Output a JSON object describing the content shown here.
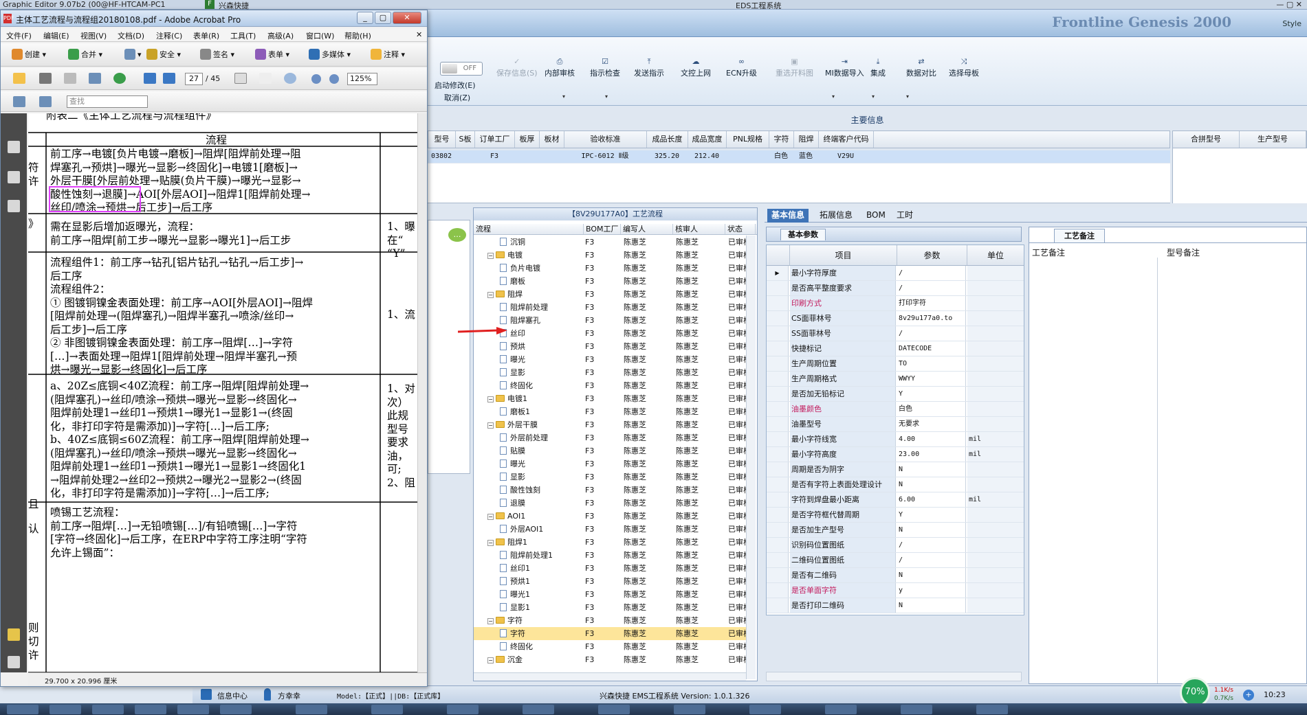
{
  "os": {
    "title_left": "Graphic Editor 9.07b2 (00@HF-HTCAM-PC1",
    "eds_title": "EDS工程系统",
    "tab_left": "兴森快捷"
  },
  "eds": {
    "brand": "Frontline Genesis 2000",
    "style_label": "Style",
    "toggle": "OFF",
    "ribbon": [
      {
        "label": "启动修改(E)",
        "icon": "toggle-icon",
        "disabled": false
      },
      {
        "label": "保存信息(S)",
        "icon": "check-icon",
        "disabled": true
      },
      {
        "label": "内部审核",
        "icon": "printer-icon",
        "disabled": false
      },
      {
        "label": "指示检查",
        "icon": "checkbox-icon",
        "disabled": false
      },
      {
        "label": "发送指示",
        "icon": "upload-icon",
        "disabled": false
      },
      {
        "label": "文控上网",
        "icon": "cloud-upload-icon",
        "disabled": false
      },
      {
        "label": "ECN升级",
        "icon": "binoculars-icon",
        "disabled": false
      },
      {
        "label": "重选开料图",
        "icon": "image-icon",
        "disabled": true
      },
      {
        "label": "MI数据导入",
        "icon": "import-icon",
        "disabled": false
      },
      {
        "label": "集成",
        "icon": "download-icon",
        "disabled": false
      },
      {
        "label": "数据对比",
        "icon": "compare-icon",
        "disabled": false
      },
      {
        "label": "选择母板",
        "icon": "shuffle-icon",
        "disabled": false
      }
    ],
    "cancel_label": "取消(Z)",
    "main_info_title": "主要信息",
    "main_columns": [
      "型号",
      "S板",
      "订单工厂",
      "板厚",
      "板材",
      "验收标准",
      "成品长度",
      "成品宽度",
      "PNL规格",
      "字符",
      "阻焊",
      "终端客户代码"
    ],
    "main_row": [
      "03802",
      "",
      "F3",
      "",
      "",
      "IPC-6012 Ⅱ级",
      "325.20",
      "212.40",
      "",
      "白色",
      "蓝色",
      "V29U"
    ],
    "right_columns": [
      "合拼型号",
      "生产型号"
    ],
    "tree_title": "【8V29U177A0】工艺流程",
    "tree_columns": [
      "流程",
      "BOM工厂",
      "编写人",
      "核审人",
      "状态"
    ],
    "tree_rows": [
      {
        "name": "沉铜",
        "level": 2,
        "kind": "doc",
        "bom": "F3",
        "writer": "陈惠芝",
        "checker": "陈惠芝",
        "status": "已审核"
      },
      {
        "name": "电镀",
        "level": 1,
        "kind": "folder",
        "bom": "F3",
        "writer": "陈惠芝",
        "checker": "陈惠芝",
        "status": "已审核"
      },
      {
        "name": "负片电镀",
        "level": 2,
        "kind": "doc",
        "bom": "F3",
        "writer": "陈惠芝",
        "checker": "陈惠芝",
        "status": "已审核"
      },
      {
        "name": "磨板",
        "level": 2,
        "kind": "doc",
        "bom": "F3",
        "writer": "陈惠芝",
        "checker": "陈惠芝",
        "status": "已审核"
      },
      {
        "name": "阻焊",
        "level": 1,
        "kind": "folder",
        "bom": "F3",
        "writer": "陈惠芝",
        "checker": "陈惠芝",
        "status": "已审核"
      },
      {
        "name": "阻焊前处理",
        "level": 2,
        "kind": "doc",
        "bom": "F3",
        "writer": "陈惠芝",
        "checker": "陈惠芝",
        "status": "已审核"
      },
      {
        "name": "阻焊塞孔",
        "level": 2,
        "kind": "doc",
        "bom": "F3",
        "writer": "陈惠芝",
        "checker": "陈惠芝",
        "status": "已审核"
      },
      {
        "name": "丝印",
        "level": 2,
        "kind": "doc",
        "bom": "F3",
        "writer": "陈惠芝",
        "checker": "陈惠芝",
        "status": "已审核"
      },
      {
        "name": "预烘",
        "level": 2,
        "kind": "doc",
        "bom": "F3",
        "writer": "陈惠芝",
        "checker": "陈惠芝",
        "status": "已审核"
      },
      {
        "name": "曝光",
        "level": 2,
        "kind": "doc",
        "bom": "F3",
        "writer": "陈惠芝",
        "checker": "陈惠芝",
        "status": "已审核"
      },
      {
        "name": "显影",
        "level": 2,
        "kind": "doc",
        "bom": "F3",
        "writer": "陈惠芝",
        "checker": "陈惠芝",
        "status": "已审核"
      },
      {
        "name": "终固化",
        "level": 2,
        "kind": "doc",
        "bom": "F3",
        "writer": "陈惠芝",
        "checker": "陈惠芝",
        "status": "已审核"
      },
      {
        "name": "电镀1",
        "level": 1,
        "kind": "folder",
        "bom": "F3",
        "writer": "陈惠芝",
        "checker": "陈惠芝",
        "status": "已审核"
      },
      {
        "name": "磨板1",
        "level": 2,
        "kind": "doc",
        "bom": "F3",
        "writer": "陈惠芝",
        "checker": "陈惠芝",
        "status": "已审核"
      },
      {
        "name": "外层干膜",
        "level": 1,
        "kind": "folder",
        "bom": "F3",
        "writer": "陈惠芝",
        "checker": "陈惠芝",
        "status": "已审核"
      },
      {
        "name": "外层前处理",
        "level": 2,
        "kind": "doc",
        "bom": "F3",
        "writer": "陈惠芝",
        "checker": "陈惠芝",
        "status": "已审核"
      },
      {
        "name": "贴膜",
        "level": 2,
        "kind": "doc",
        "bom": "F3",
        "writer": "陈惠芝",
        "checker": "陈惠芝",
        "status": "已审核"
      },
      {
        "name": "曝光",
        "level": 2,
        "kind": "doc",
        "bom": "F3",
        "writer": "陈惠芝",
        "checker": "陈惠芝",
        "status": "已审核"
      },
      {
        "name": "显影",
        "level": 2,
        "kind": "doc",
        "bom": "F3",
        "writer": "陈惠芝",
        "checker": "陈惠芝",
        "status": "已审核"
      },
      {
        "name": "酸性蚀刻",
        "level": 2,
        "kind": "doc",
        "bom": "F3",
        "writer": "陈惠芝",
        "checker": "陈惠芝",
        "status": "已审核"
      },
      {
        "name": "退膜",
        "level": 2,
        "kind": "doc",
        "bom": "F3",
        "writer": "陈惠芝",
        "checker": "陈惠芝",
        "status": "已审核"
      },
      {
        "name": "AOI1",
        "level": 1,
        "kind": "folder",
        "bom": "F3",
        "writer": "陈惠芝",
        "checker": "陈惠芝",
        "status": "已审核"
      },
      {
        "name": "外层AOI1",
        "level": 2,
        "kind": "doc",
        "bom": "F3",
        "writer": "陈惠芝",
        "checker": "陈惠芝",
        "status": "已审核"
      },
      {
        "name": "阻焊1",
        "level": 1,
        "kind": "folder",
        "bom": "F3",
        "writer": "陈惠芝",
        "checker": "陈惠芝",
        "status": "已审核"
      },
      {
        "name": "阻焊前处理1",
        "level": 2,
        "kind": "doc",
        "bom": "F3",
        "writer": "陈惠芝",
        "checker": "陈惠芝",
        "status": "已审核"
      },
      {
        "name": "丝印1",
        "level": 2,
        "kind": "doc",
        "bom": "F3",
        "writer": "陈惠芝",
        "checker": "陈惠芝",
        "status": "已审核"
      },
      {
        "name": "预烘1",
        "level": 2,
        "kind": "doc",
        "bom": "F3",
        "writer": "陈惠芝",
        "checker": "陈惠芝",
        "status": "已审核"
      },
      {
        "name": "曝光1",
        "level": 2,
        "kind": "doc",
        "bom": "F3",
        "writer": "陈惠芝",
        "checker": "陈惠芝",
        "status": "已审核"
      },
      {
        "name": "显影1",
        "level": 2,
        "kind": "doc",
        "bom": "F3",
        "writer": "陈惠芝",
        "checker": "陈惠芝",
        "status": "已审核"
      },
      {
        "name": "字符",
        "level": 1,
        "kind": "folder",
        "bom": "F3",
        "writer": "陈惠芝",
        "checker": "陈惠芝",
        "status": "已审核"
      },
      {
        "name": "字符",
        "level": 2,
        "kind": "doc",
        "bom": "F3",
        "writer": "陈惠芝",
        "checker": "陈惠芝",
        "status": "已审核",
        "selected": true
      },
      {
        "name": "终固化",
        "level": 2,
        "kind": "doc",
        "bom": "F3",
        "writer": "陈惠芝",
        "checker": "陈惠芝",
        "status": "已审核"
      },
      {
        "name": "沉金",
        "level": 1,
        "kind": "folder",
        "bom": "F3",
        "writer": "陈惠芝",
        "checker": "陈惠芝",
        "status": "已审核"
      }
    ],
    "tabs": [
      "基本信息",
      "拓展信息",
      "BOM",
      "工时"
    ],
    "basic_params_title": "基本参数",
    "param_columns": [
      "项目",
      "参数",
      "单位"
    ],
    "params": [
      {
        "k": "最小字符厚度",
        "v": "/",
        "u": "",
        "pink": false
      },
      {
        "k": "是否高平整度要求",
        "v": "/",
        "u": "",
        "pink": false
      },
      {
        "k": "印刷方式",
        "v": "打印字符",
        "u": "",
        "pink": true
      },
      {
        "k": "CS面菲林号",
        "v": "8v29u177a0.to",
        "u": "",
        "pink": false
      },
      {
        "k": "SS面菲林号",
        "v": "/",
        "u": "",
        "pink": false
      },
      {
        "k": "快捷标记",
        "v": "DATECODE",
        "u": "",
        "pink": false
      },
      {
        "k": "生产周期位置",
        "v": "TO",
        "u": "",
        "pink": false
      },
      {
        "k": "生产周期格式",
        "v": "WWYY",
        "u": "",
        "pink": false
      },
      {
        "k": "是否加无铅标记",
        "v": "Y",
        "u": "",
        "pink": false
      },
      {
        "k": "油墨颜色",
        "v": "白色",
        "u": "",
        "pink": true
      },
      {
        "k": "油墨型号",
        "v": "无要求",
        "u": "",
        "pink": false
      },
      {
        "k": "最小字符线宽",
        "v": "4.00",
        "u": "mil",
        "pink": false
      },
      {
        "k": "最小字符高度",
        "v": "23.00",
        "u": "mil",
        "pink": false
      },
      {
        "k": "周期是否为阴字",
        "v": "N",
        "u": "",
        "pink": false
      },
      {
        "k": "是否有字符上表面处理设计",
        "v": "N",
        "u": "",
        "pink": false
      },
      {
        "k": "字符到焊盘最小距离",
        "v": "6.00",
        "u": "mil",
        "pink": false
      },
      {
        "k": "是否字符框代替周期",
        "v": "Y",
        "u": "",
        "pink": false
      },
      {
        "k": "是否加生产型号",
        "v": "N",
        "u": "",
        "pink": false
      },
      {
        "k": "识别码位置图纸",
        "v": "/",
        "u": "",
        "pink": false
      },
      {
        "k": "二维码位置图纸",
        "v": "/",
        "u": "",
        "pink": false
      },
      {
        "k": "是否有二维码",
        "v": "N",
        "u": "",
        "pink": false
      },
      {
        "k": "是否单面字符",
        "v": "y",
        "u": "",
        "pink": true
      },
      {
        "k": "是否打印二维码",
        "v": "N",
        "u": "",
        "pink": false
      }
    ],
    "remark_tab": "工艺备注",
    "remark_columns": [
      "工艺备注",
      "型号备注"
    ],
    "status": {
      "info_center": "信息中心",
      "user": "方幸幸",
      "model": "Model:【正式】||DB:【正式库】",
      "app": "兴森快捷  EMS工程系统  Version: 1.0.1.326",
      "gauge": "70%",
      "up": "1.1K/s",
      "down": "0.7K/s",
      "time": "10:23"
    }
  },
  "acrobat": {
    "title": "主体工艺流程与流程组20180108.pdf - Adobe Acrobat Pro",
    "menu": [
      "文件(F)",
      "编辑(E)",
      "视图(V)",
      "文档(D)",
      "注释(C)",
      "表单(R)",
      "工具(T)",
      "高级(A)",
      "窗口(W)",
      "帮助(H)"
    ],
    "toolbar": [
      "创建",
      "合并",
      "",
      "安全",
      "签名",
      "表单",
      "多媒体",
      "注释"
    ],
    "page_current": "27",
    "page_total": "/ 45",
    "zoom": "125%",
    "find_placeholder": "查找",
    "page_size": "29.700 x 20.996 厘米",
    "doc": {
      "heading": "附表二《主体工艺流程与流程组件》",
      "col_header": "流程",
      "left_marks": [
        "符",
        "许",
        "》",
        "且",
        "认",
        "则",
        "切",
        "许"
      ],
      "block1": [
        "前工序→电镀[负片电镀→磨板]→阻焊[阻焊前处理→阻",
        "焊塞孔→预烘]→曝光→显影→终固化]→电镀1[磨板]→",
        "外层干膜[外层前处理→贴膜(负片干膜)→曝光→显影→",
        "酸性蚀刻→退膜]→AOI[外层AOI]→阻焊1[阻焊前处理→",
        "丝印/喷涂→预烘→后工步]→后工序"
      ],
      "block2": [
        "需在显影后增加返曝光，流程：",
        "前工序→阻焊[前工步→曝光→显影→曝光1]→后工步"
      ],
      "block3": [
        "流程组件1：前工序→钻孔[铝片钻孔→钻孔→后工步]→",
        "后工序",
        "流程组件2：",
        "① 图镀铜镍金表面处理：前工序→AOI[外层AOI]→阻焊",
        "[阻焊前处理→(阻焊塞孔)→阻焊半塞孔→喷涂/丝印→",
        "后工步]→后工序",
        "② 非图镀铜镍金表面处理：前工序→阻焊[…]→字符",
        "[…]→表面处理→阻焊1[阻焊前处理→阻焊半塞孔→预",
        "烘→曝光→显影→终固化]→后工序"
      ],
      "block4": [
        "a、20Z≤底铜<40Z流程：前工序→阻焊[阻焊前处理→",
        "(阻焊塞孔)→丝印/喷涂→预烘→曝光→显影→终固化→",
        "阻焊前处理1→丝印1→预烘1→曝光1→显影1→(终固",
        "化，非打印字符是需添加)]→字符[…]→后工序;",
        "b、40Z≤底铜≤60Z流程：前工序→阻焊[阻焊前处理→",
        "(阻焊塞孔)→丝印/喷涂→预烘→曝光→显影→终固化→",
        "阻焊前处理1→丝印1→预烘1→曝光1→显影1→终固化1",
        "→阻焊前处理2→丝印2→预烘2→曝光2→显影2→(终固",
        "化，非打印字符是需添加)]→字符[…]→后工序;"
      ],
      "block5": [
        "喷锡工艺流程：",
        "前工序→阻焊[…]→无铅喷锡[…]/有铅喷锡[…]→字符",
        "[字符→终固化]→后工序，在ERP中字符工序注明“字符",
        "允许上锡面”："
      ],
      "right1": [
        "1、曝",
        "在“",
        "“Y”"
      ],
      "right2": [
        "1、流"
      ],
      "right3": [
        "1、对",
        "次）",
        "此规",
        "型号",
        "要求",
        "油，",
        "可;",
        "2、阻"
      ]
    }
  }
}
